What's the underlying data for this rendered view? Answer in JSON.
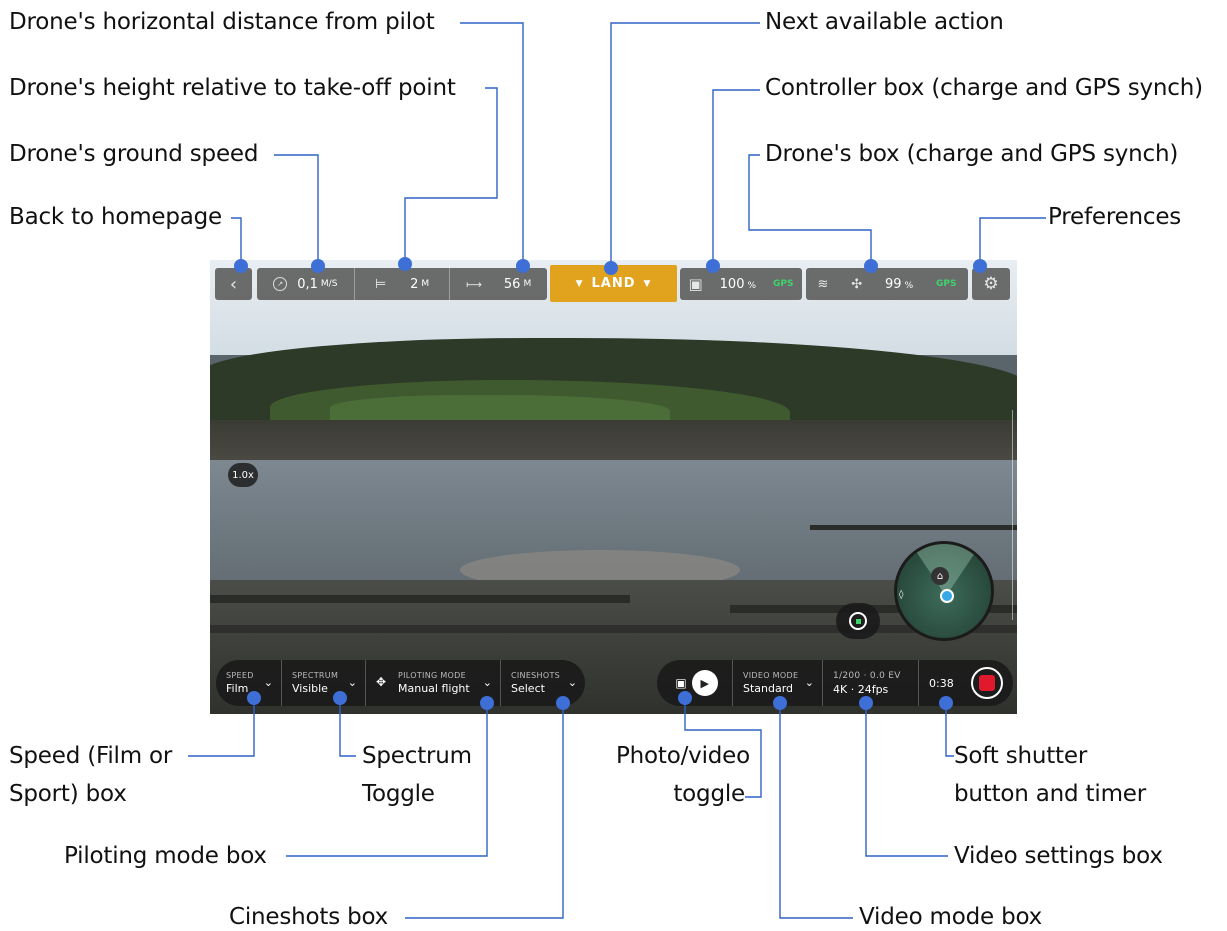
{
  "annotations": {
    "horizontal_distance": "Drone's horizontal distance from pilot",
    "height": "Drone's height relative to take-off point",
    "ground_speed": "Drone's ground speed",
    "back": "Back to homepage",
    "next_action": "Next available action",
    "controller_box": "Controller box (charge and GPS synch)",
    "drone_box": "Drone's box (charge and GPS synch)",
    "preferences": "Preferences",
    "speed_box_line1": "Speed (Film or",
    "speed_box_line2": "Sport) box",
    "spectrum_line1": "Spectrum",
    "spectrum_line2": "Toggle",
    "piloting_mode_box": "Piloting mode box",
    "cineshots_box": "Cineshots box",
    "photo_video_line1": "Photo/video",
    "photo_video_line2": "toggle",
    "soft_shutter_line1": "Soft shutter",
    "soft_shutter_line2": "button and timer",
    "video_settings_box": "Video settings box",
    "video_mode_box": "Video mode box"
  },
  "topbar": {
    "speed_value": "0,1",
    "speed_unit": "M/S",
    "height_value": "2",
    "height_unit": "M",
    "distance_value": "56",
    "distance_unit": "M",
    "action_label": "LAND",
    "controller_charge": "100",
    "controller_charge_unit": "%",
    "controller_gps": "GPS",
    "drone_charge": "99",
    "drone_charge_unit": "%",
    "drone_gps": "GPS"
  },
  "zoom_level": "1.0x",
  "bottombar": {
    "speed_caption": "SPEED",
    "speed_value": "Film",
    "spectrum_caption": "SPECTRUM",
    "spectrum_value": "Visible",
    "piloting_caption": "PILOTING MODE",
    "piloting_value": "Manual flight",
    "cineshots_caption": "CINESHOTS",
    "cineshots_value": "Select",
    "video_mode_caption": "VIDEO MODE",
    "video_mode_value": "Standard",
    "video_settings_caption": "1/200 · 0.0 EV",
    "video_settings_value": "4K · 24fps",
    "timer": "0:38"
  },
  "colors": {
    "action_button": "#e1a21d",
    "gps_ok": "#3fd46b",
    "record": "#e0192c",
    "callout_line": "#2f62c6"
  },
  "icons": [
    "back-chevron-icon",
    "speedometer-icon",
    "height-icon",
    "distance-icon",
    "controller-icon",
    "wifi-icon",
    "drone-icon",
    "gear-icon",
    "move-icon",
    "camera-icon",
    "video-camera-icon",
    "chevron-down-icon",
    "target-icon",
    "home-icon",
    "compass-icon"
  ]
}
